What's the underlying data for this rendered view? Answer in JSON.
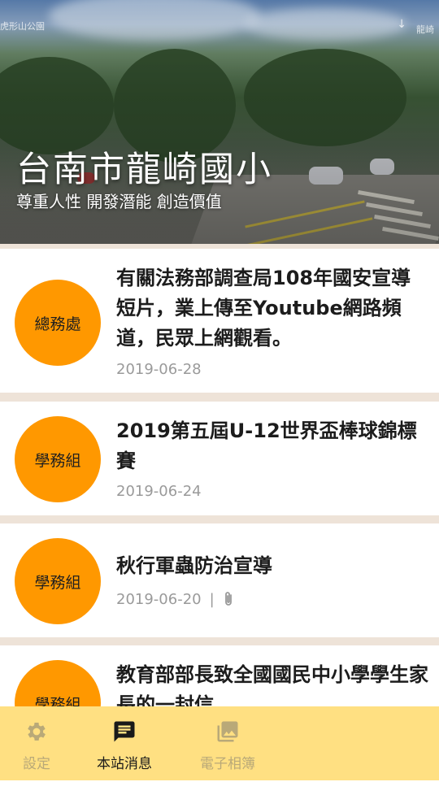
{
  "header": {
    "school_name": "台南市龍崎國小",
    "motto": "尊重人性 開發潛能 創造價值",
    "photo_watermark_left": "虎形山公園",
    "photo_watermark_right": "龍崎"
  },
  "news": [
    {
      "department": "總務處",
      "title": "有關法務部調查局108年國安宣導短片，業上傳至Youtube網路頻道，民眾上網觀看。",
      "date": "2019-06-28",
      "has_attachment": false
    },
    {
      "department": "學務組",
      "title": "2019第五屆U-12世界盃棒球錦標賽",
      "date": "2019-06-24",
      "has_attachment": false
    },
    {
      "department": "學務組",
      "title": "秋行軍蟲防治宣導",
      "date": "2019-06-20",
      "separator": "|",
      "has_attachment": true,
      "attachment_icon": "paperclip-icon"
    },
    {
      "department": "學務組",
      "title": "教育部部長致全國國民中小學學生家長的一封信",
      "date": "",
      "has_attachment": false
    }
  ],
  "bottom_nav": {
    "items": [
      {
        "label": "設定",
        "icon": "gear-icon",
        "active": false
      },
      {
        "label": "本站消息",
        "icon": "message-icon",
        "active": true
      },
      {
        "label": "電子相簿",
        "icon": "photo-album-icon",
        "active": false
      }
    ]
  },
  "colors": {
    "badge": "#ff9800",
    "nav_background": "#ffe082",
    "nav_inactive": "#b9a978",
    "list_separator": "#eee3d8"
  }
}
